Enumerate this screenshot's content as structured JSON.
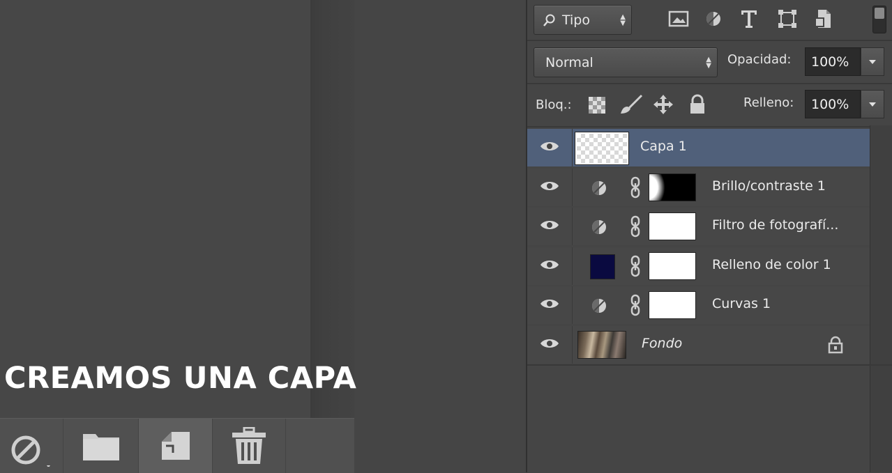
{
  "caption": "CREAMOS UNA CAPA",
  "filter": {
    "kind_label": "Tipo",
    "icons": [
      "image-filter-icon",
      "adjustment-filter-icon",
      "type-filter-icon",
      "shape-filter-icon",
      "smart-object-filter-icon"
    ]
  },
  "blend": {
    "mode": "Normal",
    "opacity_label": "Opacidad:",
    "opacity_value": "100%"
  },
  "lock": {
    "label": "Bloq.:",
    "fill_label": "Relleno:",
    "fill_value": "100%",
    "icons": [
      "lock-transparent-icon",
      "lock-paint-icon",
      "lock-position-icon",
      "lock-all-icon"
    ]
  },
  "layers": [
    {
      "name": "Capa 1",
      "selected": true,
      "thumb": "transparent"
    },
    {
      "name": "Brillo/contraste 1",
      "adjustment": true,
      "mask": "gradient"
    },
    {
      "name": "Filtro de fotografí...",
      "adjustment": true,
      "mask": "white"
    },
    {
      "name": "Relleno de color 1",
      "fill_color": "#0a0a40",
      "mask": "white"
    },
    {
      "name": "Curvas 1",
      "adjustment": true,
      "mask": "white"
    },
    {
      "name": "Fondo",
      "italic": true,
      "locked": true,
      "thumb": "photo"
    }
  ],
  "colors": {
    "selected_row": "#50607a",
    "panel_bg": "#454545",
    "fill_color_swatch": "#0a0a40"
  },
  "bottom_bar": [
    "adjustment-layer-icon",
    "new-group-folder-icon",
    "new-layer-icon",
    "trash-icon"
  ]
}
